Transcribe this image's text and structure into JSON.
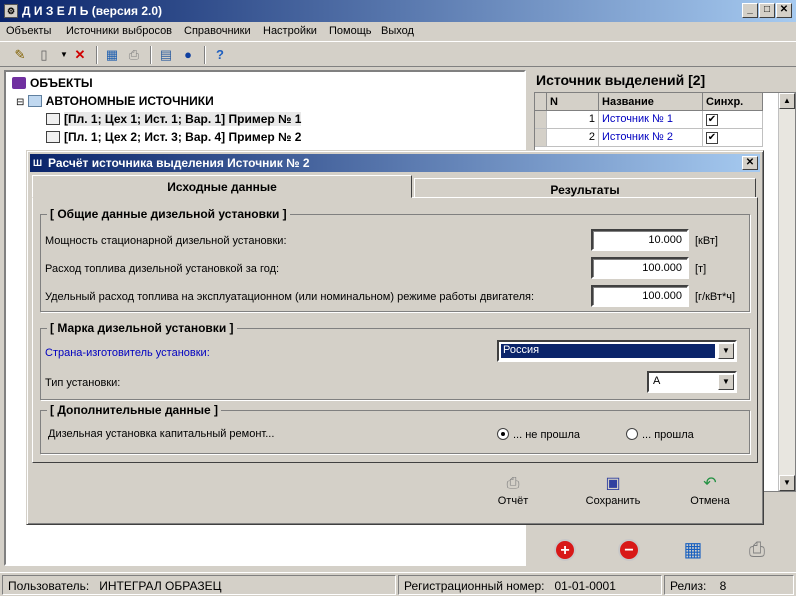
{
  "window": {
    "title": "Д И З Е Л Ь (версия 2.0)",
    "app_icon": "gear-icon",
    "btn_min": "_",
    "btn_max": "□",
    "btn_close": "✕"
  },
  "menu": [
    "Объекты",
    "Источники выбросов",
    "Справочники",
    "Настройки",
    "Помощь",
    "Выход"
  ],
  "toolbar_icons": [
    "edit-icon",
    "new-document-icon",
    "dropdown-arrow-icon",
    "delete-icon",
    "calculator-icon",
    "print-icon",
    "map-icon",
    "globe-icon",
    "help-icon"
  ],
  "tree": {
    "root": "ОБЪЕКТЫ",
    "group": "АВТОНОМНЫЕ ИСТОЧНИКИ",
    "items": [
      "[Пл. 1; Цех 1; Ист. 1; Вар. 1] Пример № 1",
      "[Пл. 1; Цех 2; Ист. 3; Вар. 4] Пример № 2"
    ]
  },
  "sources": {
    "title": "Источник выделений [2]",
    "columns": [
      "N",
      "Название",
      "Синхр."
    ],
    "rows": [
      {
        "n": "1",
        "name": "Источник № 1",
        "sync": "✔"
      },
      {
        "n": "2",
        "name": "Источник № 2",
        "sync": "✔"
      }
    ]
  },
  "status": {
    "user_label": "Пользователь:",
    "user": "ИНТЕГРАЛ ОБРАЗЕЦ",
    "reg_label": "Регистрационный номер:",
    "reg": "01-01-0001",
    "release_label": "Релиз:",
    "release": "8"
  },
  "dialog": {
    "title": "Расчёт источника выделения  Источник № 2",
    "close": "✕",
    "tabs": [
      "Исходные данные",
      "Результаты"
    ],
    "general": {
      "title": "[ Общие данные дизельной установки ]",
      "rows": [
        {
          "label": "Мощность стационарной дизельной установки:",
          "value": "10.000",
          "unit": "[кВт]"
        },
        {
          "label": "Расход топлива дизельной установкой за год:",
          "value": "100.000",
          "unit": "[т]"
        },
        {
          "label": "Удельный расход топлива на эксплуатационном (или номинальном) режиме работы двигателя:",
          "value": "100.000",
          "unit": "[г/кВт*ч]"
        }
      ]
    },
    "brand": {
      "title": "[ Марка дизельной установки ]",
      "country_label": "Страна-изготовитель установки:",
      "country": "Россия",
      "type_label": "Тип установки:",
      "type": "А"
    },
    "extra": {
      "title": "[ Дополнительные данные ]",
      "repair_label": "Дизельная установка капитальный ремонт...",
      "option_not_passed": "... не прошла",
      "option_passed": "... прошла",
      "selected": "not_passed"
    },
    "buttons": {
      "report": "Отчёт",
      "save": "Сохранить",
      "cancel": "Отмена"
    }
  },
  "colors": {
    "titlebar": "#0a246a",
    "selection": "#0a246a",
    "link_blue": "#0000c0"
  }
}
